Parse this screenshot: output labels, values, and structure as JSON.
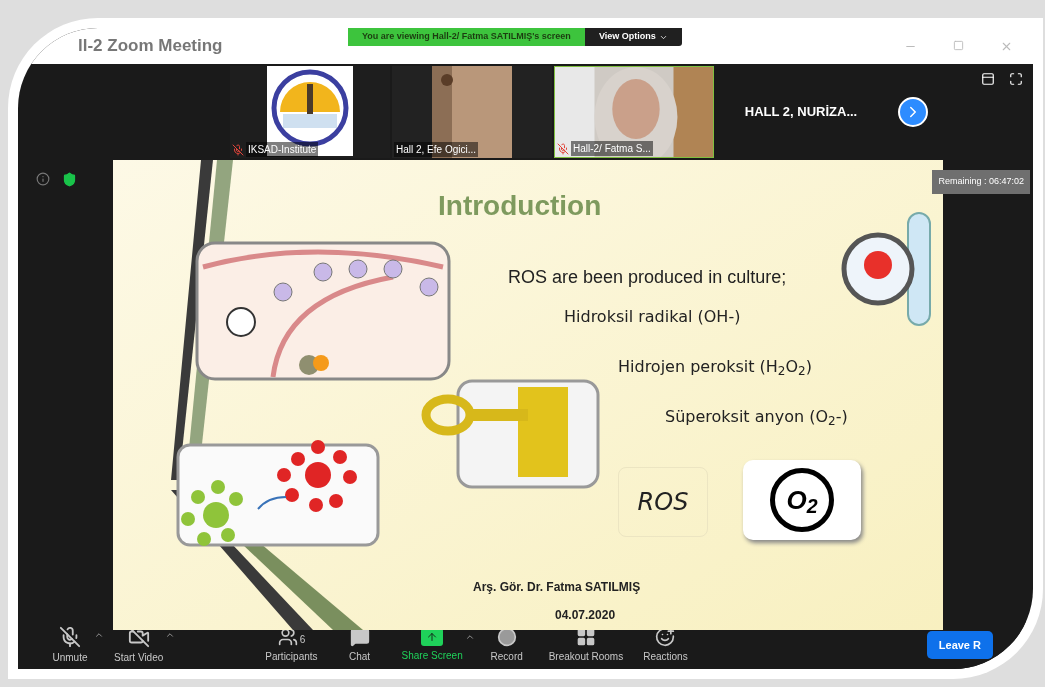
{
  "window": {
    "title": "ll-2  Zoom Meeting"
  },
  "banner": {
    "text": "You are viewing Hall-2/ Fatma SATILMIŞ's screen",
    "button": "View Options"
  },
  "videos": [
    {
      "kind": "logo",
      "name": "IKSAD-Institute",
      "muted": true
    },
    {
      "kind": "room",
      "name": "Hall 2, Efe Ogici...",
      "muted": false
    },
    {
      "kind": "person",
      "name": "Hall-2/ Fatma S...",
      "muted": true
    },
    {
      "kind": "nameonly",
      "name": "HALL 2, NURİZA..."
    }
  ],
  "remaining": "Remaining : 06:47:02",
  "slide": {
    "title": "Introduction",
    "lines": [
      "ROS are been produced in culture;",
      "Hidroksil radikal (OH-)",
      "Hidrojen peroksit (H$_{2}$O$_{2}$)",
      "Süperoksit anyon (O$_{2}$-)"
    ],
    "ros_label": "ROS",
    "o2_label": "O$_{2}$",
    "author": "Arş. Gör. Dr. Fatma SATILMIŞ",
    "date": "04.07.2020"
  },
  "toolbar": [
    {
      "kind": "mic",
      "label": "Unmute",
      "caret": true
    },
    {
      "kind": "video",
      "label": "Start Video",
      "caret": true
    },
    {
      "kind": "participants",
      "label": "Participants",
      "count": "6",
      "caret": false
    },
    {
      "kind": "chat",
      "label": "Chat",
      "caret": false
    },
    {
      "kind": "share",
      "label": "Share Screen",
      "caret": true,
      "highlight": true
    },
    {
      "kind": "record",
      "label": "Record",
      "caret": false
    },
    {
      "kind": "breakout",
      "label": "Breakout Rooms",
      "caret": false
    },
    {
      "kind": "reactions",
      "label": "Reactions",
      "caret": false
    }
  ],
  "leave_button": "Leave R"
}
